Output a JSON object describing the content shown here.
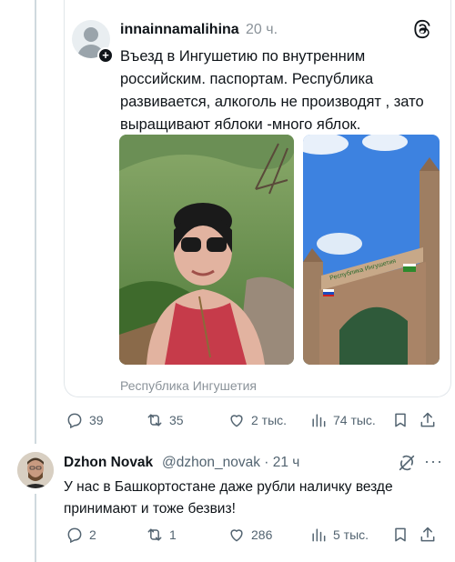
{
  "quoted_post": {
    "username": "innainnamalihina",
    "time": "20 ч.",
    "text": "Въезд в Ингушетию по внутренним российским. паспортам. Республика развивается, алкоголь не производят , зато выращивают яблоки -много яблок.",
    "location": "Республика Ингушетия",
    "stats": {
      "replies": "39",
      "reposts": "35",
      "likes": "2 тыс.",
      "views": "74 тыс."
    }
  },
  "reply": {
    "name": "Dzhon Novak",
    "handle_time": "@dzhon_novak · 21 ч",
    "text": "У нас в Башкортостане даже рубли наличку везде принимают и тоже безвиз!",
    "stats": {
      "replies": "2",
      "reposts": "1",
      "likes": "286",
      "views": "5 тыс."
    }
  },
  "icons": [
    "add-icon",
    "threads-logo-icon",
    "reply-icon",
    "repost-icon",
    "like-icon",
    "views-icon",
    "bookmark-icon",
    "share-icon",
    "grok-icon",
    "more-icon"
  ],
  "colors": {
    "text": "#0f1419",
    "muted": "#536471",
    "border": "#cfd9de",
    "sky": "#3d82e0"
  }
}
